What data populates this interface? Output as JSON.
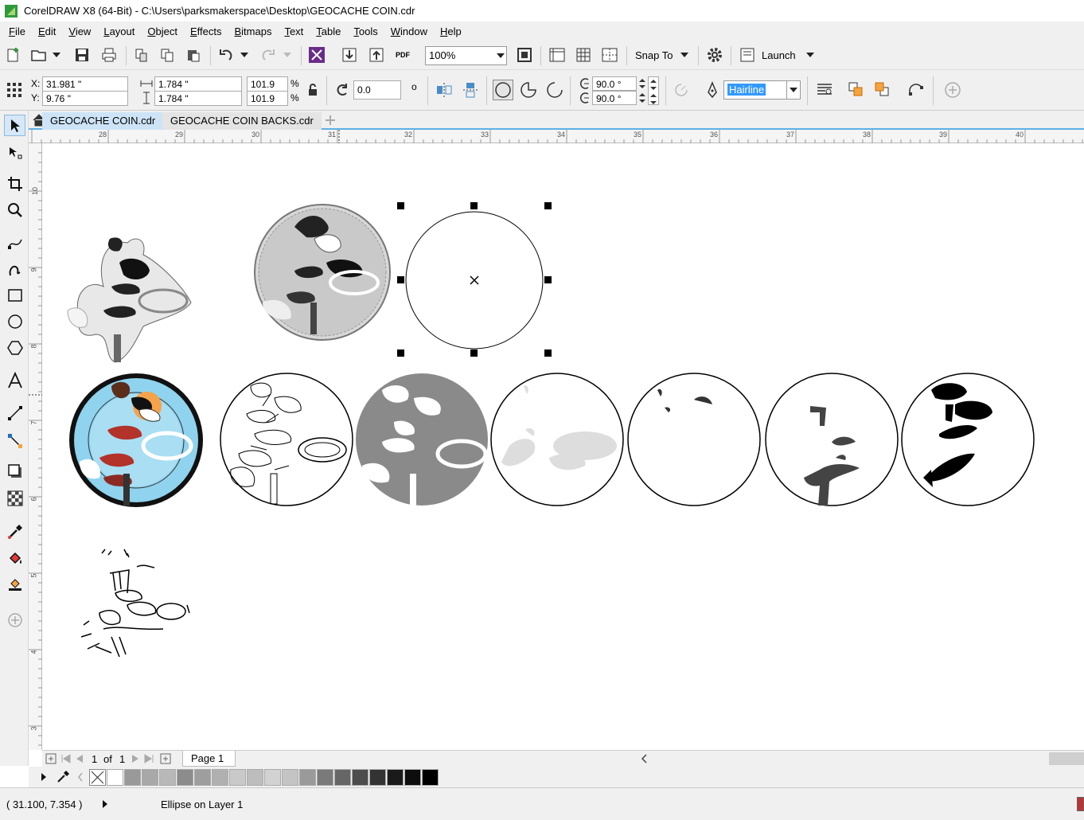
{
  "window": {
    "title": "CorelDRAW X8 (64-Bit) - C:\\Users\\parksmakerspace\\Desktop\\GEOCACHE COIN.cdr"
  },
  "menu": [
    "File",
    "Edit",
    "View",
    "Layout",
    "Object",
    "Effects",
    "Bitmaps",
    "Text",
    "Table",
    "Tools",
    "Window",
    "Help"
  ],
  "standard_toolbar": {
    "pdf_label": "PDF",
    "zoom_value": "100%",
    "snap_to_label": "Snap To",
    "launch_label": "Launch"
  },
  "property_bar": {
    "x_label": "X:",
    "x_value": "31.981 \"",
    "y_label": "Y:",
    "y_value": "9.76 \"",
    "width_value": "1.784 \"",
    "height_value": "1.784 \"",
    "scale_w": "101.9",
    "scale_h": "101.9",
    "percent": "%",
    "rotation_value": "0.0",
    "degree_symbol": "o",
    "start_angle": "90.0 °",
    "end_angle": "90.0 °",
    "outline_width": "Hairline"
  },
  "document_tabs": [
    {
      "label": "GEOCACHE COIN.cdr",
      "active": true
    },
    {
      "label": "GEOCACHE COIN BACKS.cdr",
      "active": false
    }
  ],
  "ruler": {
    "horizontal_ticks": [
      "28",
      "29",
      "30",
      "31",
      "32",
      "33",
      "34",
      "35",
      "36",
      "37",
      "38",
      "39",
      "40"
    ],
    "vertical_ticks": [
      "10",
      "9",
      "8",
      "7",
      "6",
      "5",
      "4",
      "3"
    ]
  },
  "page_nav": {
    "current_page": "1",
    "of_label": "of",
    "total_pages": "1",
    "page_tab_label": "Page 1"
  },
  "palette": {
    "colors": [
      "#ffffff",
      "#999999",
      "#a8a8a8",
      "#b8b8b8",
      "#8c8c8c",
      "#9e9e9e",
      "#b0b0b0",
      "#c9c9c9",
      "#bdbdbd",
      "#d2d2d2",
      "#c4c4c4",
      "#9a9a9a",
      "#7a7a7a",
      "#666666",
      "#4d4d4d",
      "#333333",
      "#1a1a1a",
      "#0d0d0d",
      "#000000"
    ]
  },
  "status": {
    "cursor_position": "( 31.100, 7.354 )",
    "selection_info": "Ellipse on Layer 1"
  },
  "colors": {
    "chrome": "#f0f0f0",
    "accent": "#5eb0e6",
    "selection_highlight": "#3399ff",
    "coin_blue": "#8fd3ee",
    "fill_gray": "#8a8a8a"
  },
  "canvas_objects": [
    "coin-trace-bitmap",
    "coin-gray-photo",
    "selected-ellipse",
    "coin-color-photo",
    "coin-outline-trace",
    "coin-gray-fill-layer",
    "coin-lightgray-layer",
    "coin-small-marks-layer",
    "coin-darkgray-layer",
    "coin-black-layer",
    "sketch-line-art"
  ]
}
